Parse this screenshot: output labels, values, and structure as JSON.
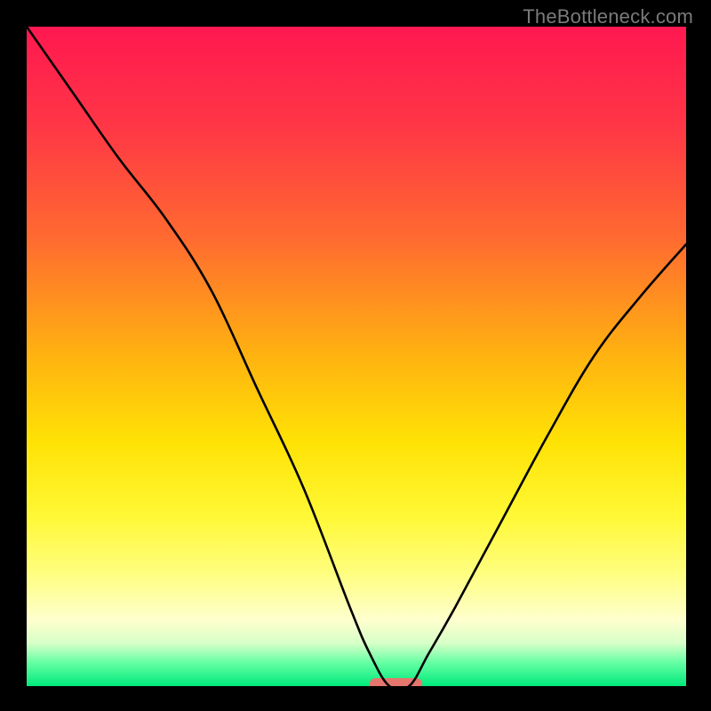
{
  "watermark": "TheBottleneck.com",
  "chart_data": {
    "type": "line",
    "title": "",
    "xlabel": "",
    "ylabel": "",
    "xlim": [
      0,
      100
    ],
    "ylim": [
      0,
      100
    ],
    "series": [
      {
        "name": "bottleneck-curve",
        "x": [
          0,
          7,
          14,
          21,
          28,
          35,
          42,
          49,
          52,
          55,
          58,
          61,
          65,
          72,
          79,
          86,
          93,
          100
        ],
        "values": [
          100,
          90,
          80,
          71,
          60,
          45,
          30,
          12,
          5,
          0,
          0,
          5,
          12,
          25,
          38,
          50,
          59,
          67
        ]
      }
    ],
    "marker": {
      "x_center": 56,
      "x_width": 8,
      "y": 0,
      "color": "#e5766d"
    },
    "gradient_stops": [
      {
        "offset": 0.0,
        "color": "#ff1850"
      },
      {
        "offset": 0.15,
        "color": "#ff3646"
      },
      {
        "offset": 0.32,
        "color": "#ff6a30"
      },
      {
        "offset": 0.5,
        "color": "#ffb310"
      },
      {
        "offset": 0.63,
        "color": "#ffe205"
      },
      {
        "offset": 0.74,
        "color": "#fff834"
      },
      {
        "offset": 0.83,
        "color": "#fffe80"
      },
      {
        "offset": 0.9,
        "color": "#feffce"
      },
      {
        "offset": 0.935,
        "color": "#d7ffc8"
      },
      {
        "offset": 0.965,
        "color": "#64ffa3"
      },
      {
        "offset": 1.0,
        "color": "#00e97b"
      }
    ]
  }
}
